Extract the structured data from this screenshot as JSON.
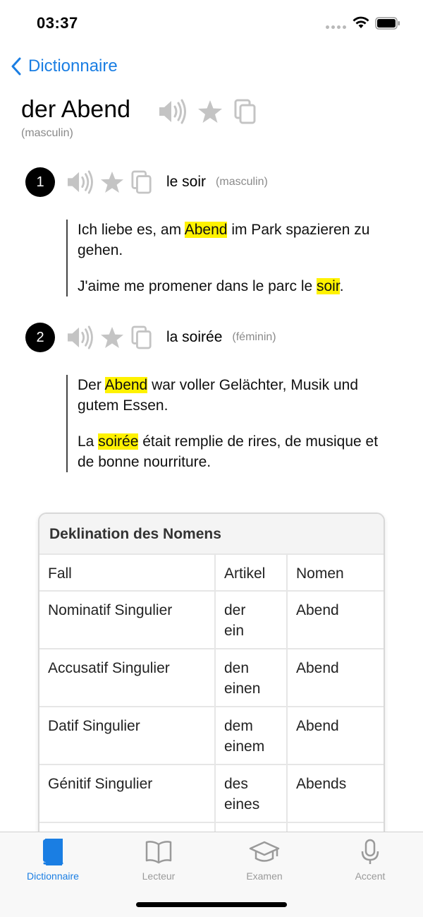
{
  "status": {
    "time": "03:37"
  },
  "nav": {
    "back_label": "Dictionnaire"
  },
  "entry": {
    "headword": "der Abend",
    "gender": "(masculin)"
  },
  "senses": [
    {
      "number": "1",
      "translation": "le soir",
      "gender": "(masculin)",
      "example_de": {
        "before": "Ich liebe es, am ",
        "highlight": "Abend",
        "after": " im Park spazieren zu gehen."
      },
      "example_fr": {
        "before": "J'aime me promener dans le parc le ",
        "highlight": "soir",
        "after": "."
      }
    },
    {
      "number": "2",
      "translation": "la soirée",
      "gender": "(féminin)",
      "example_de": {
        "before": "Der ",
        "highlight": "Abend",
        "after": " war voller Gelächter, Musik und gutem Essen."
      },
      "example_fr": {
        "before": "La ",
        "highlight": "soirée",
        "after": " était remplie de rires, de musique et de bonne nourriture."
      }
    }
  ],
  "declension": {
    "title": "Deklination des Nomens",
    "headers": [
      "Fall",
      "Artikel",
      "Nomen"
    ],
    "rows": [
      {
        "case": "Nominatif Singulier",
        "article_1": "der",
        "article_2": "ein",
        "noun": "Abend"
      },
      {
        "case": "Accusatif Singulier",
        "article_1": "den",
        "article_2": "einen",
        "noun": "Abend"
      },
      {
        "case": "Datif Singulier",
        "article_1": "dem",
        "article_2": "einem",
        "noun": "Abend"
      },
      {
        "case": "Génitif Singulier",
        "article_1": "des",
        "article_2": "eines",
        "noun": "Abends"
      }
    ]
  },
  "tabs": [
    {
      "label": "Dictionnaire",
      "icon": "book-icon",
      "active": true
    },
    {
      "label": "Lecteur",
      "icon": "open-book-icon",
      "active": false
    },
    {
      "label": "Examen",
      "icon": "graduation-cap-icon",
      "active": false
    },
    {
      "label": "Accent",
      "icon": "microphone-icon",
      "active": false
    }
  ],
  "colors": {
    "accent": "#1a7ee3",
    "highlight": "#fff200",
    "icon_gray": "#c4c4c4"
  }
}
